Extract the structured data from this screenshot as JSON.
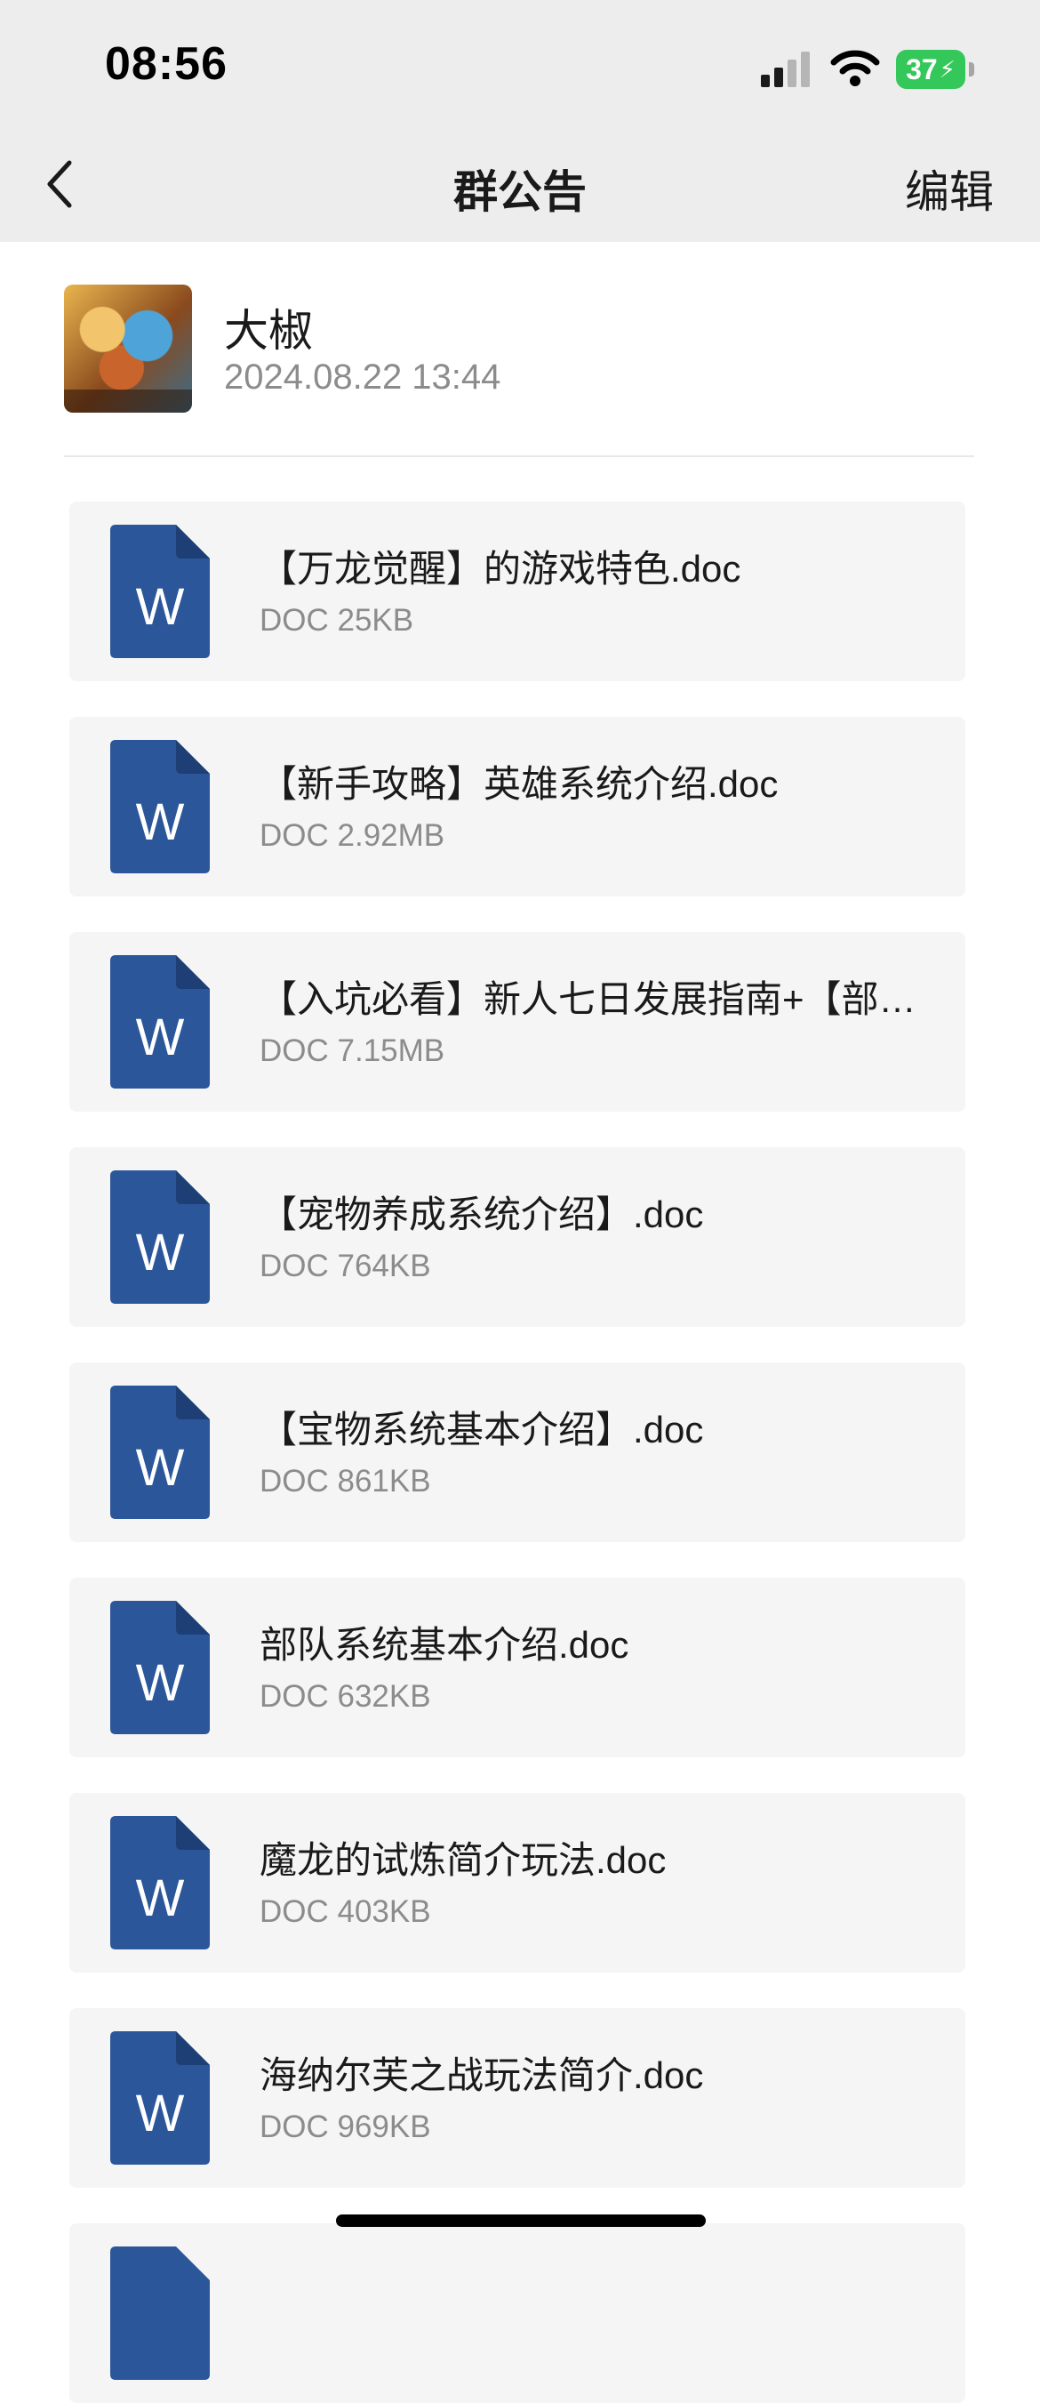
{
  "status_bar": {
    "time": "08:56",
    "battery": "37"
  },
  "nav": {
    "back_icon": "chevron-left-icon",
    "title": "群公告",
    "edit_label": "编辑"
  },
  "author": {
    "name": "大椒",
    "datetime": "2024.08.22  13:44"
  },
  "files": [
    {
      "name": "【万龙觉醒】的游戏特色.doc",
      "meta": "DOC 25KB"
    },
    {
      "name": "【新手攻略】英雄系统介绍.doc",
      "meta": "DOC 2.92MB"
    },
    {
      "name": "【入坑必看】新人七日发展指南+【部队…",
      "meta": "DOC 7.15MB"
    },
    {
      "name": "【宠物养成系统介绍】.doc",
      "meta": "DOC 764KB"
    },
    {
      "name": "【宝物系统基本介绍】.doc",
      "meta": "DOC 861KB"
    },
    {
      "name": "部队系统基本介绍.doc",
      "meta": "DOC 632KB"
    },
    {
      "name": "魔龙的试炼简介玩法.doc",
      "meta": "DOC 403KB"
    },
    {
      "name": "海纳尔芙之战玩法简介.doc",
      "meta": "DOC 969KB"
    }
  ],
  "colors": {
    "word_icon": "#2b579a",
    "word_icon_fold": "#1d3f75",
    "card_bg": "#f5f5f5",
    "battery_green": "#34c759"
  }
}
